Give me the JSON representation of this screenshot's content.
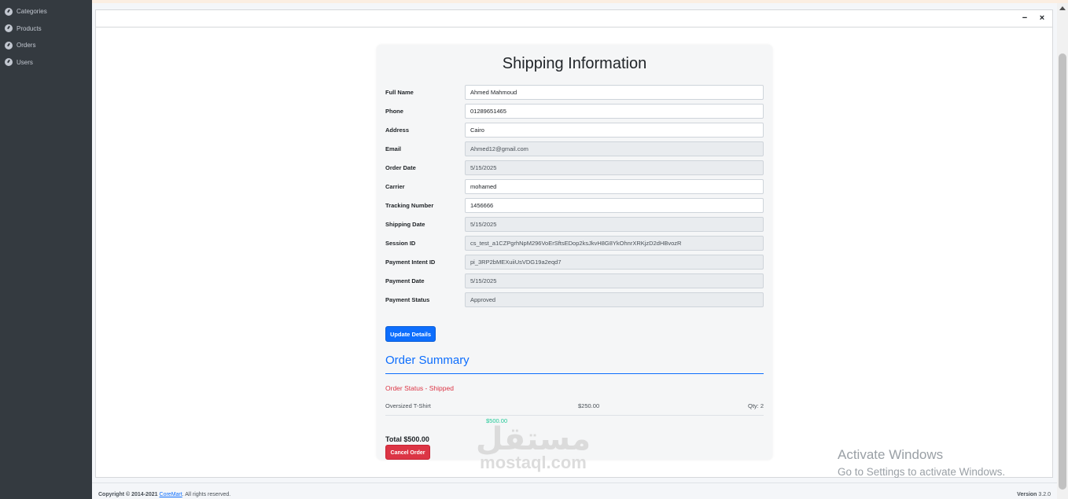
{
  "sidebar": {
    "items": [
      {
        "label": "Categories",
        "icon": "dashboard-icon"
      },
      {
        "label": "Products",
        "icon": "dashboard-icon"
      },
      {
        "label": "Orders",
        "icon": "dashboard-icon"
      },
      {
        "label": "Users",
        "icon": "dashboard-icon"
      }
    ]
  },
  "window": {
    "minimize_icon": "−",
    "close_icon": "×"
  },
  "shipping": {
    "title": "Shipping Information",
    "fields": [
      {
        "label": "Full Name",
        "value": "Ahmed Mahmoud",
        "readonly": false
      },
      {
        "label": "Phone",
        "value": "01289651465",
        "readonly": false
      },
      {
        "label": "Address",
        "value": "Cairo",
        "readonly": false
      },
      {
        "label": "Email",
        "value": "Ahmed12@gmail.com",
        "readonly": true
      },
      {
        "label": "Order Date",
        "value": "5/15/2025",
        "readonly": true
      },
      {
        "label": "Carrier",
        "value": "mohamed",
        "readonly": false
      },
      {
        "label": "Tracking Number",
        "value": "1456666",
        "readonly": false
      },
      {
        "label": "Shipping Date",
        "value": "5/15/2025",
        "readonly": true
      },
      {
        "label": "Session ID",
        "value": "cs_test_a1CZPgrhNpM296VoErSftsEDop2ksJkvH8G8YkOhnrXRKjzD2dHBvozR",
        "readonly": true
      },
      {
        "label": "Payment Intent ID",
        "value": "pi_3RP2bMEXuiiUsVDG19a2eqd7",
        "readonly": true
      },
      {
        "label": "Payment Date",
        "value": "5/15/2025",
        "readonly": true
      },
      {
        "label": "Payment Status",
        "value": "Approved",
        "readonly": true
      }
    ],
    "update_button": "Update Details"
  },
  "summary": {
    "title": "Order Summary",
    "status_text": "Order Status - Shipped",
    "items": [
      {
        "name": "Oversized T-Shirt",
        "price": "$250.00",
        "qty": "Qty: 2",
        "subtotal": "$500.00"
      }
    ],
    "total": "Total $500.00",
    "cancel_button": "Cancel Order"
  },
  "watermark": {
    "logo": "مستقل",
    "text": "mostaql.com"
  },
  "activation": {
    "title": "Activate Windows",
    "subtitle": "Go to Settings to activate Windows."
  },
  "footer": {
    "copyright_prefix": "Copyright © 2014-2021",
    "brand": "CoreMart",
    "rights": ". All rights reserved.",
    "version_label": "Version",
    "version": "3.2.0"
  },
  "colors": {
    "primary": "#0d6efd",
    "danger": "#dc3545",
    "sidebar": "#343a40",
    "success_text": "#20c997"
  }
}
